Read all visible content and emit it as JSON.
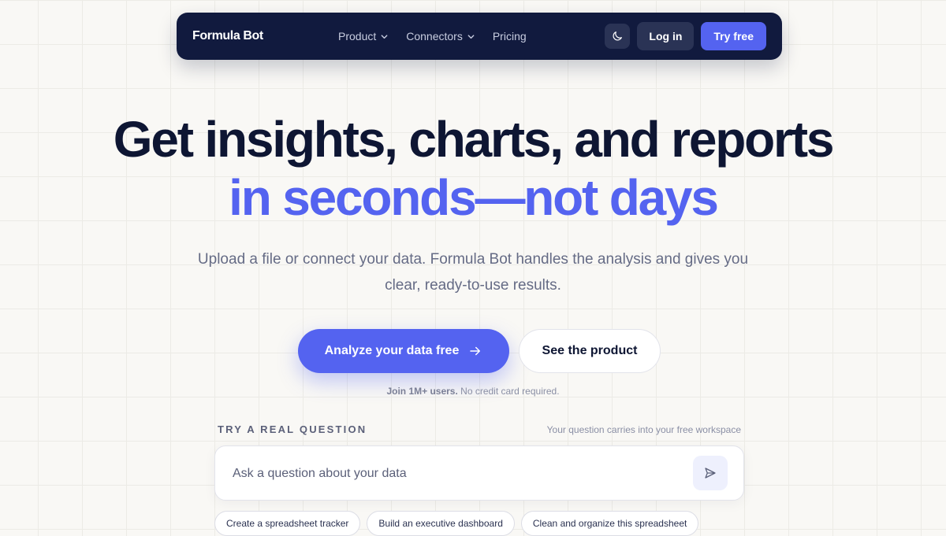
{
  "nav": {
    "brand": "Formula Bot",
    "links": [
      {
        "label": "Product"
      },
      {
        "label": "Connectors"
      },
      {
        "label": "Pricing"
      }
    ],
    "login_label": "Log in",
    "try_label": "Try free"
  },
  "hero": {
    "headline_line1": "Get insights, charts, and reports",
    "headline_line2": "in seconds—not days",
    "subheadline": "Upload a file or connect your data. Formula Bot handles the analysis and gives you clear, ready-to-use results.",
    "cta_primary": "Analyze your data free",
    "cta_secondary": "See the product",
    "note_bold": "Join 1M+ users.",
    "note_rest": " No credit card required."
  },
  "question": {
    "label": "TRY A REAL QUESTION",
    "hint": "Your question carries into your free workspace",
    "placeholder": "Ask a question about your data",
    "value": "",
    "chips": [
      "Create a spreadsheet tracker",
      "Build an executive dashboard",
      "Clean and organize this spreadsheet"
    ]
  },
  "icons": {
    "theme": "moon-icon",
    "dropdown": "chevron-down-icon",
    "cta_arrow": "arrow-right-icon",
    "send": "send-icon"
  },
  "colors": {
    "nav_bg": "#111a3e",
    "accent": "#5463f0",
    "headline": "#0e1633",
    "body_text": "#656b85",
    "page_bg": "#f9f8f5"
  }
}
